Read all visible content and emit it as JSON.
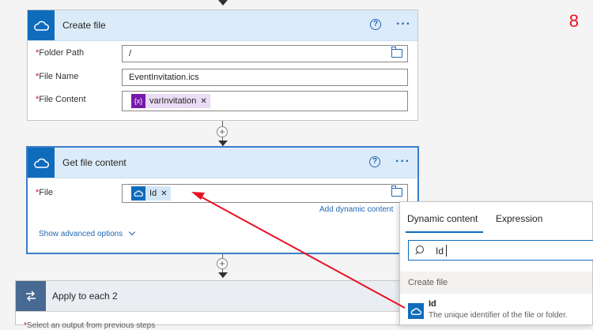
{
  "step_number": "8",
  "create_file": {
    "title": "Create file",
    "help_icon": "?",
    "more_icon": "···",
    "fields": {
      "folder_path": {
        "label": "Folder Path",
        "value": "/"
      },
      "file_name": {
        "label": "File Name",
        "value": "EventInvitation.ics"
      },
      "file_content": {
        "label": "File Content",
        "token": "varInvitation",
        "token_icon": "{x}"
      }
    }
  },
  "get_file_content": {
    "title": "Get file content",
    "help_icon": "?",
    "more_icon": "···",
    "file_label": "File",
    "file_token": "Id",
    "add_dynamic_content": "Add dynamic content",
    "show_advanced": "Show advanced options"
  },
  "apply_to_each": {
    "title": "Apply to each 2",
    "partial_label": "Select an output from previous steps"
  },
  "dynamic_panel": {
    "tabs": [
      "Dynamic content",
      "Expression"
    ],
    "active_tab": "Dynamic content",
    "search_value": "Id",
    "section_title": "Create file",
    "results": [
      {
        "name": "Id",
        "description": "The unique identifier of the file or folder."
      }
    ]
  },
  "colors": {
    "accent": "#0f6cbd",
    "annotation_arrow": "#e81123",
    "required": "#c50f1f",
    "variable_token": "#7719aa"
  }
}
